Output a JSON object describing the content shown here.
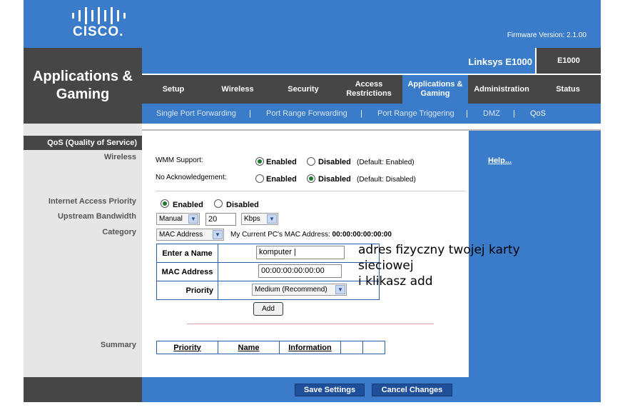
{
  "header": {
    "logo_text": "CISCO.",
    "firmware": "Firmware Version: 2.1.00",
    "section_title_line1": "Applications &",
    "section_title_line2": "Gaming",
    "product_name": "Linksys E1000",
    "model": "E1000"
  },
  "tabs": [
    {
      "label": "Setup"
    },
    {
      "label": "Wireless"
    },
    {
      "label": "Security"
    },
    {
      "label": "Access Restrictions"
    },
    {
      "label": "Applications & Gaming"
    },
    {
      "label": "Administration"
    },
    {
      "label": "Status"
    }
  ],
  "subtabs": [
    {
      "label": "Single Port Forwarding"
    },
    {
      "label": "Port Range Forwarding"
    },
    {
      "label": "Port Range Triggering"
    },
    {
      "label": "DMZ"
    },
    {
      "label": "QoS"
    }
  ],
  "left": {
    "heading": "QoS (Quality of Service)",
    "wireless": "Wireless",
    "iap": "Internet Access Priority",
    "upstream": "Upstream Bandwidth",
    "category": "Category",
    "summary": "Summary"
  },
  "help": "Help...",
  "wireless": {
    "wmm_label": "WMM Support:",
    "wmm_enabled": "Enabled",
    "wmm_disabled": "Disabled",
    "wmm_default": "(Default: Enabled)",
    "noack_label": "No Acknowledgement:",
    "noack_enabled": "Enabled",
    "noack_disabled": "Disabled",
    "noack_default": "(Default: Disabled)"
  },
  "iap": {
    "enabled": "Enabled",
    "disabled": "Disabled",
    "mode": "Manual",
    "bandwidth": "20",
    "unit": "Kbps",
    "category": "MAC Address",
    "mac_info_label": "My Current PC's MAC Address:",
    "mac_info_value": "00:00:00:00:00:00"
  },
  "entry": {
    "name_label": "Enter a Name",
    "name_value": "komputer |",
    "mac_label": "MAC Address",
    "mac_value": "00:00:00:00:00:00",
    "priority_label": "Priority",
    "priority_value": "Medium (Recommend)",
    "add_button": "Add"
  },
  "annotation": "adres fizyczny twojej karty\nsieciowej\ni klikasz add",
  "summary_headers": [
    "Priority",
    "Name",
    "Information",
    "",
    ""
  ],
  "footer": {
    "save": "Save Settings",
    "cancel": "Cancel Changes"
  },
  "colors": {
    "brand_blue": "#3a7cc9",
    "dark_grey": "#464646",
    "light_grey": "#e6e6e6"
  }
}
